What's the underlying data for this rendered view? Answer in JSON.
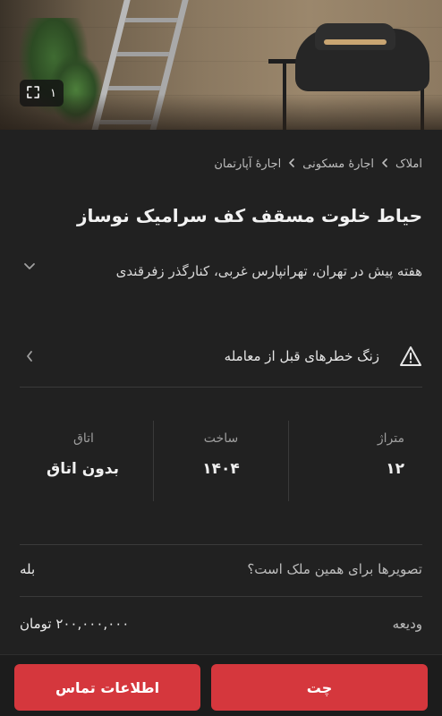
{
  "gallery": {
    "counter": "۱"
  },
  "breadcrumb": [
    "املاک",
    "اجارهٔ مسکونی",
    "اجارهٔ آپارتمان"
  ],
  "listing": {
    "title": "حیاط خلوت مسقف کف سرامیک نوساز",
    "subtitle": "هفته پیش در تهران، تهرانپارس غربی، کنارگذر زفرقندی"
  },
  "danger": {
    "label": "زنگ خطرهای قبل از معامله"
  },
  "stats": [
    {
      "key": "متراژ",
      "value": "۱۲"
    },
    {
      "key": "ساخت",
      "value": "۱۴۰۴"
    },
    {
      "key": "اتاق",
      "value": "بدون اتاق"
    }
  ],
  "details": {
    "photos_question": "تصویرها برای همین ملک است؟",
    "photos_answer": "بله",
    "deposit_label": "ودیعه",
    "deposit_value": "۲۰۰,۰۰۰,۰۰۰ تومان"
  },
  "actions": {
    "chat": "چت",
    "contact": "اطلاعات تماس"
  },
  "colors": {
    "accent": "#d5373d",
    "background": "#212121"
  },
  "icons": [
    "fullscreen-icon",
    "chevron-left-icon",
    "chevron-down-icon",
    "warning-icon"
  ]
}
